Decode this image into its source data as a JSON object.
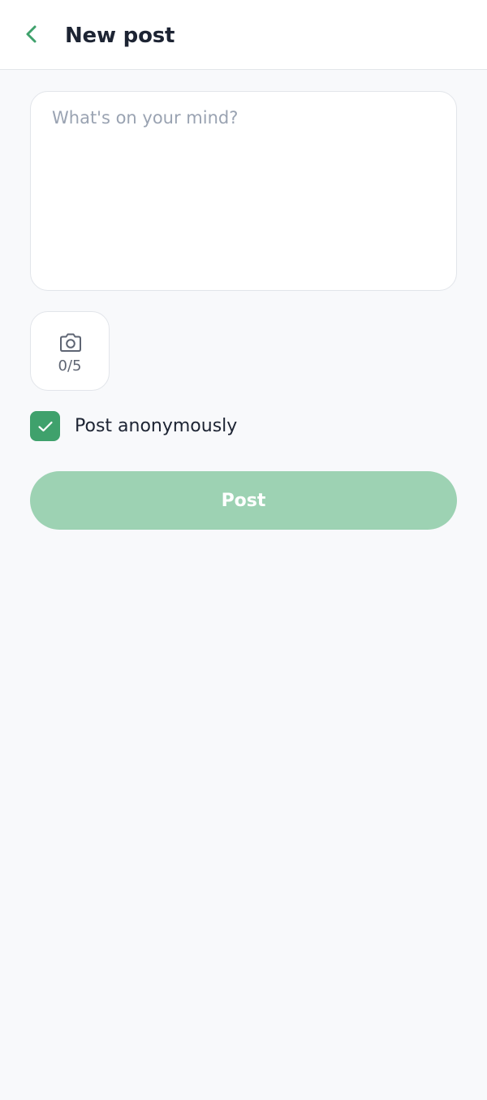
{
  "header": {
    "title": "New post",
    "back_icon": "chevron-left-icon"
  },
  "composer": {
    "value": "",
    "placeholder": "What's on your mind?"
  },
  "photos": {
    "icon": "camera-icon",
    "count_label": "0/5"
  },
  "anonymous": {
    "checked": true,
    "label": "Post anonymously"
  },
  "submit": {
    "label": "Post",
    "enabled": false
  },
  "colors": {
    "accent": "#3fa16c",
    "accent_disabled": "#9dd2b3",
    "background": "#f8f9fb",
    "surface": "#ffffff",
    "text_primary": "#1d2433",
    "placeholder": "#9aa3b2"
  }
}
